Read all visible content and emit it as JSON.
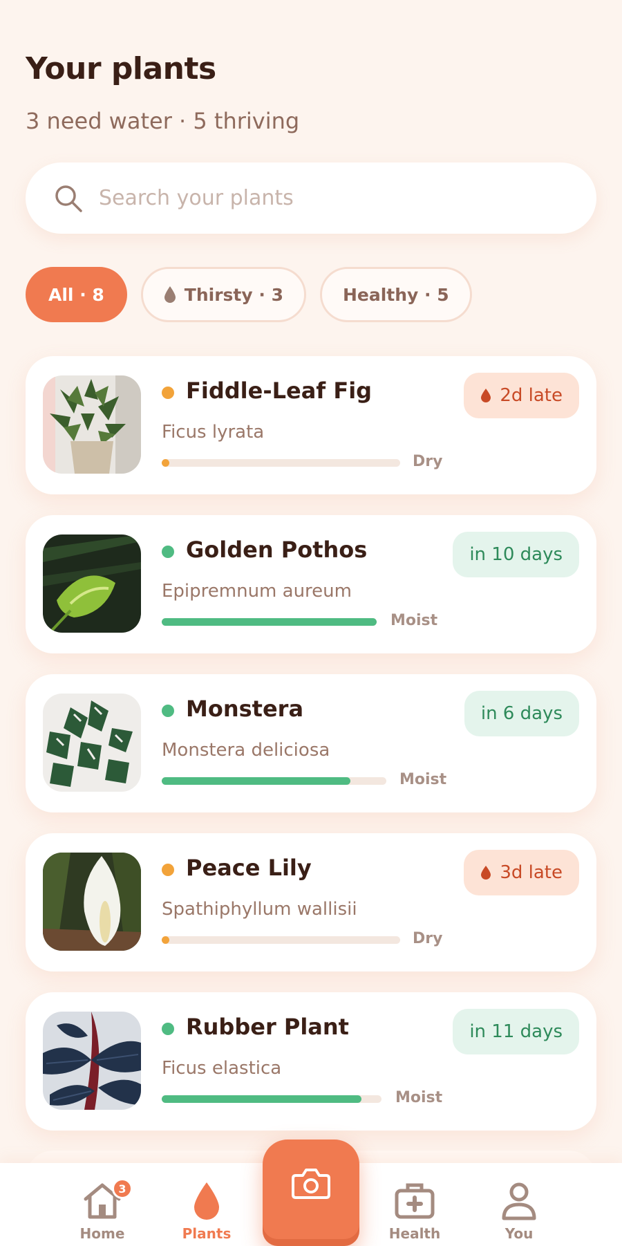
{
  "header": {
    "title": "Your plants",
    "subtitle": "3 need water · 5 thriving"
  },
  "search": {
    "placeholder": "Search your plants",
    "value": ""
  },
  "filters": [
    {
      "label": "All · 8",
      "active": true
    },
    {
      "label": "Thirsty · 3",
      "active": false,
      "icon": "drop-icon"
    },
    {
      "label": "Healthy · 5",
      "active": false
    }
  ],
  "plants": [
    {
      "name": "Fiddle-Leaf Fig",
      "scientific": "Ficus lyrata",
      "status_dot": "#f2a33a",
      "moisture_label": "Dry",
      "moisture_level": 0.03,
      "moisture_color": "#f2a33a",
      "water_status": "2d late",
      "water_state": "late"
    },
    {
      "name": "Golden Pothos",
      "scientific": "Epipremnum aureum",
      "status_dot": "#4fbb82",
      "moisture_label": "Moist",
      "moisture_level": 1.0,
      "moisture_color": "#4fbb82",
      "water_status": "in 10 days",
      "water_state": "ok"
    },
    {
      "name": "Monstera",
      "scientific": "Monstera deliciosa",
      "status_dot": "#4fbb82",
      "moisture_label": "Moist",
      "moisture_level": 0.84,
      "moisture_color": "#4fbb82",
      "water_status": "in 6 days",
      "water_state": "ok"
    },
    {
      "name": "Peace Lily",
      "scientific": "Spathiphyllum wallisii",
      "status_dot": "#f2a33a",
      "moisture_label": "Dry",
      "moisture_level": 0.03,
      "moisture_color": "#f2a33a",
      "water_status": "3d late",
      "water_state": "late"
    },
    {
      "name": "Rubber Plant",
      "scientific": "Ficus elastica",
      "status_dot": "#4fbb82",
      "moisture_label": "Moist",
      "moisture_level": 0.91,
      "moisture_color": "#4fbb82",
      "water_status": "in 11 days",
      "water_state": "ok"
    }
  ],
  "nav": {
    "home": {
      "label": "Home",
      "badge": "3"
    },
    "plants": {
      "label": "Plants"
    },
    "camera": {
      "icon": "camera-icon"
    },
    "health": {
      "label": "Health"
    },
    "you": {
      "label": "You"
    }
  },
  "colors": {
    "accent": "#f07a50",
    "background": "#fdf4ee",
    "healthy": "#4fbb82",
    "thirsty": "#f2a33a"
  }
}
